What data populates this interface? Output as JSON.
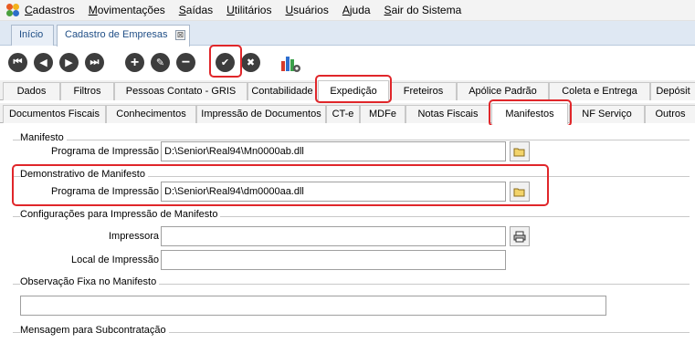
{
  "menu": {
    "items": [
      "Cadastros",
      "Movimentações",
      "Saídas",
      "Utilitários",
      "Usuários",
      "Ajuda",
      "Sair do Sistema"
    ]
  },
  "doc_tabs": {
    "home": "Início",
    "active": "Cadastro de Empresas",
    "close_glyph": "⊠"
  },
  "toolbar": {
    "first": "⏮",
    "prev": "◀",
    "next": "▶",
    "last": "⏭",
    "add": "+",
    "edit": "✎",
    "remove": "−",
    "confirm": "✔",
    "cancel": "✖"
  },
  "main_tabs": [
    "Dados",
    "Filtros",
    "Pessoas Contato - GRIS",
    "Contabilidade",
    "Expedição",
    "Freteiros",
    "Apólice Padrão",
    "Coleta e Entrega",
    "Depósit"
  ],
  "sub_tabs": [
    "Documentos Fiscais",
    "Conhecimentos",
    "Impressão de Documentos",
    "CT-e",
    "MDFe",
    "Notas Fiscais",
    "Manifestos",
    "NF Serviço",
    "Outros"
  ],
  "sections": {
    "manifesto": {
      "title": "Manifesto",
      "program_label": "Programa de Impressão",
      "program_value": "D:\\Senior\\Real94\\Mn0000ab.dll"
    },
    "demonstrativo": {
      "title": "Demonstrativo de Manifesto",
      "program_label": "Programa de Impressão",
      "program_value": "D:\\Senior\\Real94\\dm0000aa.dll"
    },
    "configuracoes": {
      "title": "Configurações para Impressão de Manifesto",
      "printer_label": "Impressora",
      "printer_value": "",
      "location_label": "Local de Impressão",
      "location_value": ""
    },
    "observacao": {
      "title": "Observação Fixa no Manifesto",
      "value": ""
    },
    "mensagem": {
      "title": "Mensagem para Subcontratação"
    }
  },
  "colors": {
    "highlight": "#e0262a",
    "tab_text": "#1f4e86"
  }
}
